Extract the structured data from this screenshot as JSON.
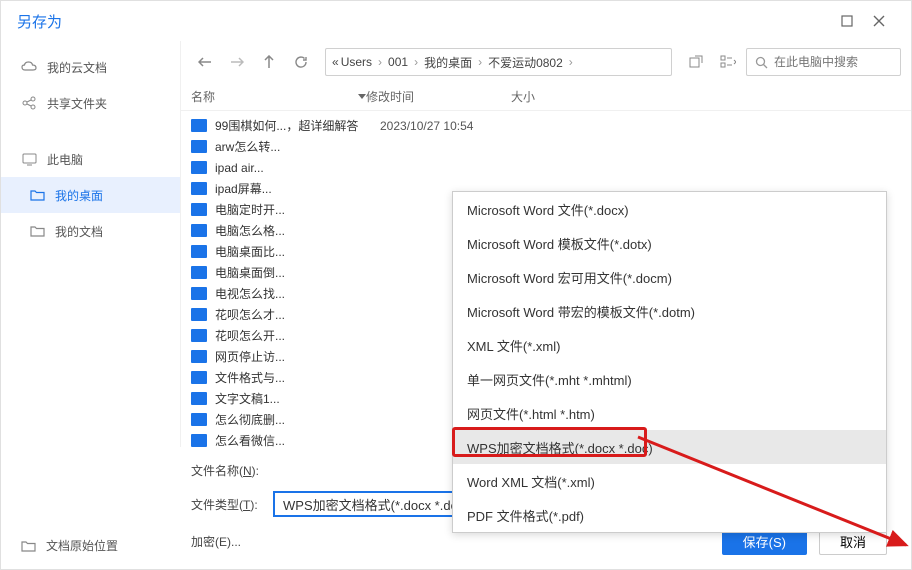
{
  "title": "另存为",
  "sidebar": {
    "cloud": "我的云文档",
    "share": "共享文件夹",
    "pc": "此电脑",
    "desktop": "我的桌面",
    "docs": "我的文档",
    "orig": "文档原始位置"
  },
  "breadcrumb": [
    "Users",
    "001",
    "我的桌面",
    "不爱运动0802"
  ],
  "search_placeholder": "在此电脑中搜索",
  "columns": {
    "name": "名称",
    "date": "修改时间",
    "size": "大小"
  },
  "files": [
    {
      "name": "99围棋如何...，超详细解答",
      "date": "2023/10/27 10:54"
    },
    {
      "name": "arw怎么转...",
      "date": ""
    },
    {
      "name": "ipad air...",
      "date": ""
    },
    {
      "name": "ipad屏幕...",
      "date": ""
    },
    {
      "name": "电脑定时开...",
      "date": ""
    },
    {
      "name": "电脑怎么格...",
      "date": ""
    },
    {
      "name": "电脑桌面比...",
      "date": ""
    },
    {
      "name": "电脑桌面倒...",
      "date": ""
    },
    {
      "name": "电视怎么找...",
      "date": ""
    },
    {
      "name": "花呗怎么才...",
      "date": ""
    },
    {
      "name": "花呗怎么开...",
      "date": ""
    },
    {
      "name": "网页停止访...",
      "date": ""
    },
    {
      "name": "文件格式与...",
      "date": ""
    },
    {
      "name": "文字文稿1...",
      "date": ""
    },
    {
      "name": "怎么彻底删...",
      "date": ""
    },
    {
      "name": "怎么看微信...",
      "date": ""
    }
  ],
  "type_options": [
    "Microsoft Word 文件(*.docx)",
    "Microsoft Word 模板文件(*.dotx)",
    "Microsoft Word 宏可用文件(*.docm)",
    "Microsoft Word 带宏的模板文件(*.dotm)",
    "XML 文件(*.xml)",
    "单一网页文件(*.mht *.mhtml)",
    "网页文件(*.html *.htm)",
    "WPS加密文档格式(*.docx *.doc)",
    "Word XML 文档(*.xml)",
    "PDF 文件格式(*.pdf)"
  ],
  "form": {
    "name_label": "文件名称(N):",
    "type_label": "文件类型(T):",
    "encrypt_label": "加密(E)...",
    "type_value": "WPS加密文档格式(*.docx *.doc)"
  },
  "buttons": {
    "save": "保存(S)",
    "cancel": "取消"
  }
}
